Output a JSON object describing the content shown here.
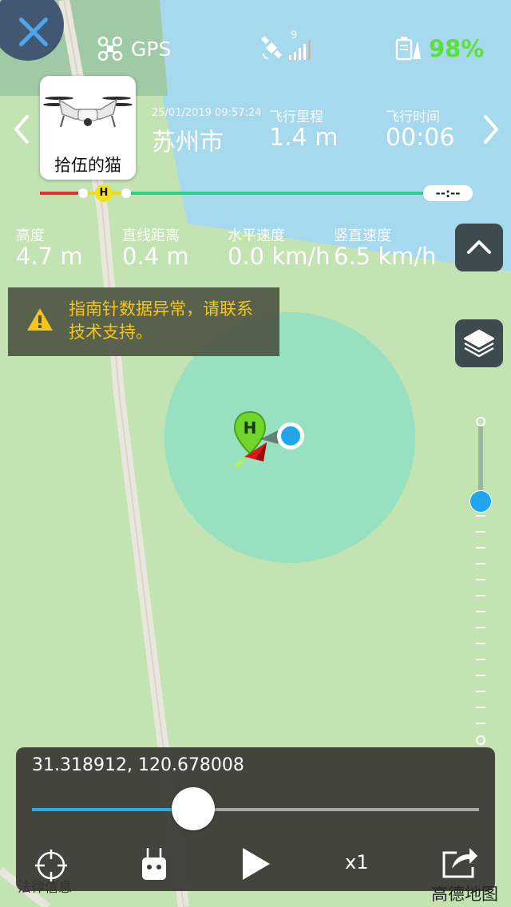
{
  "status": {
    "gps_label": "GPS",
    "satellite_count": "9",
    "battery_percent": "98%"
  },
  "flight": {
    "drone_name": "拾伍的猫",
    "datetime": "25/01/2019 09:57:24",
    "city": "苏州市",
    "distance_label": "飞行里程",
    "distance_value": "1.4 m",
    "time_label": "飞行时间",
    "time_value": "00:06",
    "timeline_end": "--:--",
    "home_marker": "H"
  },
  "metrics": [
    {
      "label": "高度",
      "value": "4.7 m"
    },
    {
      "label": "直线距离",
      "value": "0.4 m"
    },
    {
      "label": "水平速度",
      "value": "0.0 km/h"
    },
    {
      "label": "竖直速度",
      "value": "6.5 km/h"
    }
  ],
  "warning": {
    "text": "指南针数据异常，请联系技术支持。"
  },
  "map": {
    "home_marker": "H",
    "legal_text": "法律信息",
    "provider": "高德地图"
  },
  "playback": {
    "coordinates": "31.318912, 120.678008",
    "progress": 0.36,
    "speed": "x1"
  },
  "altitude_level": 0.24,
  "colors": {
    "battery": "#5ee03a",
    "warning": "#f5c518",
    "track": "#1fb1e8",
    "home_green": "#6fd62a"
  }
}
